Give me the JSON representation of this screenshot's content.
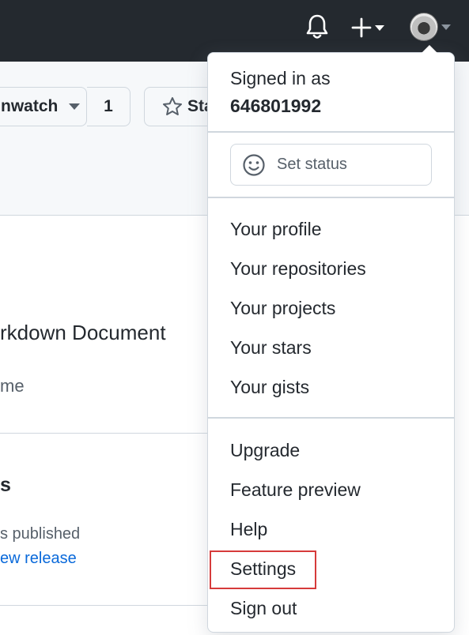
{
  "header": {
    "notifications_icon": "bell-icon",
    "create_icon": "plus-icon",
    "avatar_icon": "user-avatar"
  },
  "repo": {
    "watch_label": "nwatch",
    "watch_count": "1",
    "star_label": "Sta",
    "description_title": "rkdown Document",
    "description_sub": "me",
    "releases_heading": "s",
    "releases_text": "s published",
    "releases_link": "ew release"
  },
  "menu": {
    "signed_in_label": "Signed in as",
    "username": "646801992",
    "set_status_label": "Set status",
    "profile_items": [
      "Your profile",
      "Your repositories",
      "Your projects",
      "Your stars",
      "Your gists"
    ],
    "other_items": [
      "Upgrade",
      "Feature preview",
      "Help",
      "Settings",
      "Sign out"
    ]
  },
  "colors": {
    "header_bg": "#24292f",
    "highlight_box": "#d63b3b",
    "link": "#0969da"
  }
}
